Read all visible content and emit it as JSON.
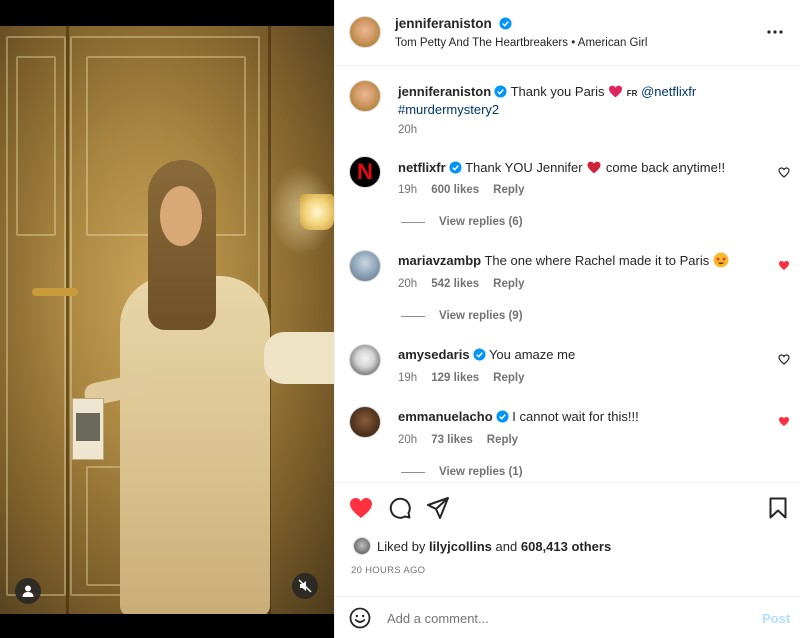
{
  "header": {
    "username": "jenniferaniston",
    "audio": "Tom Petty And The Heartbreakers • American Girl",
    "more_icon": "more-horizontal-icon"
  },
  "caption": {
    "username": "jenniferaniston",
    "text_before": "Thank you Paris",
    "fr_text": "FR",
    "mention": "@netflixfr",
    "hashtag": "#murdermystery2",
    "time": "20h"
  },
  "comments": [
    {
      "username": "netflixfr",
      "verified": true,
      "text_before": "Thank YOU Jennifer",
      "text_after": "come back anytime!!",
      "time": "19h",
      "likes": "600 likes",
      "reply": "Reply",
      "liked": false,
      "view_replies": "View replies (6)"
    },
    {
      "username": "mariavzambp",
      "verified": false,
      "text_before": "The one where Rachel made it to Paris",
      "text_after": "",
      "time": "20h",
      "likes": "542 likes",
      "reply": "Reply",
      "liked": true,
      "view_replies": "View replies (9)"
    },
    {
      "username": "amysedaris",
      "verified": true,
      "text_before": "You amaze me",
      "text_after": "",
      "time": "19h",
      "likes": "129 likes",
      "reply": "Reply",
      "liked": false,
      "view_replies": ""
    },
    {
      "username": "emmanuelacho",
      "verified": true,
      "text_before": "I cannot wait for this!!!",
      "text_after": "",
      "time": "20h",
      "likes": "73 likes",
      "reply": "Reply",
      "liked": true,
      "view_replies": "View replies (1)"
    }
  ],
  "liked_by": {
    "prefix": "Liked by",
    "user": "lilyjcollins",
    "connector": "and",
    "others": "608,413 others"
  },
  "timestamp": "20 HOURS AGO",
  "add_comment": {
    "placeholder": "Add a comment...",
    "post_label": "Post"
  },
  "colors": {
    "like_red": "#ff3040",
    "verified_blue": "#0095f6",
    "post_blue": "#b2dffc",
    "link": "#00376b"
  }
}
